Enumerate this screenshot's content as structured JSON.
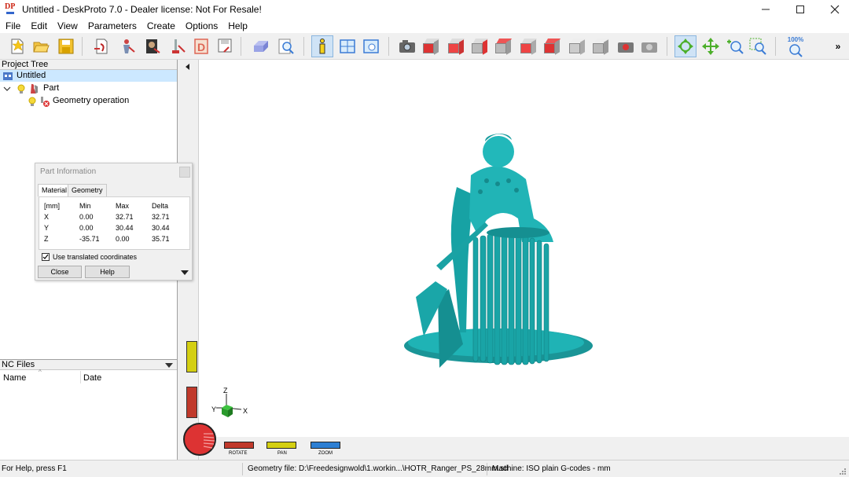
{
  "window": {
    "title": "Untitled - DeskProto 7.0 - Dealer license: Not For Resale!",
    "logo_text": "DP",
    "min_icon": "minimize-icon",
    "max_icon": "maximize-icon",
    "close_icon": "close-icon"
  },
  "menu": [
    "File",
    "Edit",
    "View",
    "Parameters",
    "Create",
    "Options",
    "Help"
  ],
  "toolbar": {
    "zoom_percent": "100%"
  },
  "project_tree": {
    "header": "Project Tree",
    "items": [
      "Untitled",
      "Part",
      "Geometry operation"
    ]
  },
  "nc_files": {
    "header": "NC Files",
    "col_name": "Name",
    "col_date": "Date"
  },
  "part_info": {
    "title": "Part Information",
    "tabs": [
      "Material",
      "Geometry"
    ],
    "unit": "[mm]",
    "headers": [
      "Min",
      "Max",
      "Delta"
    ],
    "rows": [
      {
        "axis": "X",
        "min": "0.00",
        "max": "32.71",
        "delta": "32.71"
      },
      {
        "axis": "Y",
        "min": "0.00",
        "max": "30.44",
        "delta": "30.44"
      },
      {
        "axis": "Z",
        "min": "-35.71",
        "max": "0.00",
        "delta": "35.71"
      }
    ],
    "checkbox_label": "Use translated coordinates",
    "checkbox_checked": true,
    "close_label": "Close",
    "help_label": "Help"
  },
  "viewport": {
    "axis_z": "Z",
    "axis_y": "Y",
    "axis_x": "X",
    "rotate_label": "ROTATE",
    "pan_label": "PAN",
    "zoom_label": "ZOOM",
    "model_color": "#1fb3b5"
  },
  "status": {
    "help": "For Help, press F1",
    "geometry_file": "Geometry file: D:\\Freedesignwold\\1.workin...\\HOTR_Ranger_PS_28mm.stl",
    "machine": "Machine: ISO plain G-codes - mm"
  }
}
